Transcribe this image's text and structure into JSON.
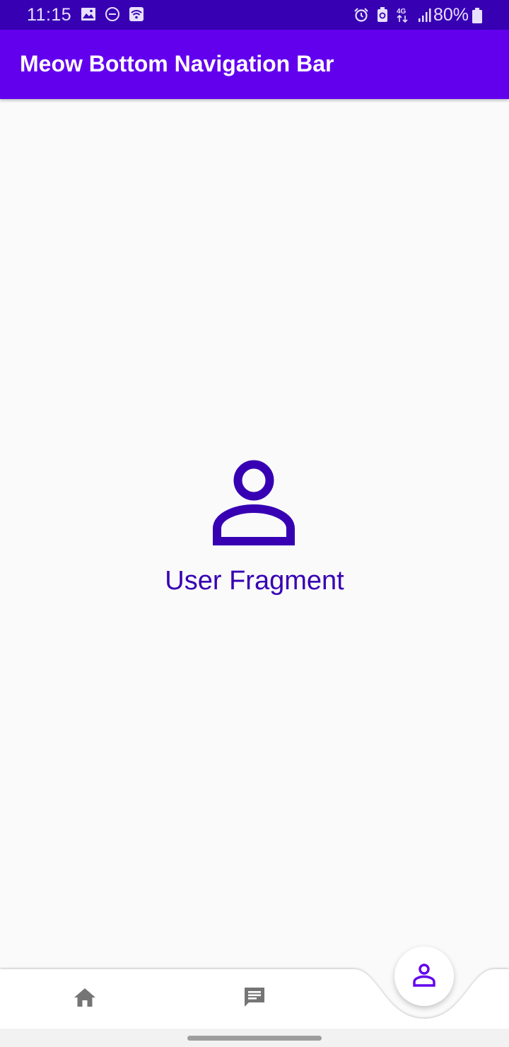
{
  "status_bar": {
    "time": "11:15",
    "battery_text": "80%",
    "network_type": "4G",
    "left_icons": [
      "image-icon",
      "do-not-disturb-icon",
      "wifi-icon"
    ],
    "right_icons": [
      "alarm-icon",
      "battery-saver-icon",
      "network-4g-icon",
      "signal-icon",
      "battery-icon"
    ]
  },
  "app_bar": {
    "title": "Meow Bottom Navigation Bar"
  },
  "main": {
    "icon": "user-icon",
    "label": "User Fragment"
  },
  "bottom_nav": {
    "items": [
      {
        "name": "home",
        "icon": "home-icon",
        "selected": false
      },
      {
        "name": "messages",
        "icon": "message-icon",
        "selected": false
      },
      {
        "name": "user",
        "icon": "user-icon",
        "selected": true
      }
    ]
  },
  "colors": {
    "status_bar": "#3700b3",
    "app_bar": "#6200ee",
    "accent": "#3700b3",
    "nav_icon_inactive": "#757575",
    "background": "#fafafa"
  }
}
